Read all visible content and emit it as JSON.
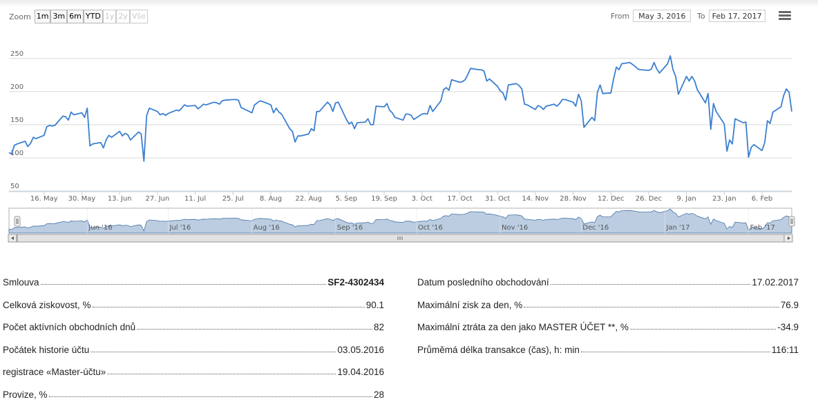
{
  "toolbar": {
    "zoom_label": "Zoom",
    "zoom_buttons": [
      {
        "label": "1m",
        "enabled": true
      },
      {
        "label": "3m",
        "enabled": true
      },
      {
        "label": "6m",
        "enabled": true
      },
      {
        "label": "YTD",
        "enabled": true
      },
      {
        "label": "1y",
        "enabled": false
      },
      {
        "label": "2y",
        "enabled": false
      },
      {
        "label": "Vše",
        "enabled": false
      }
    ],
    "from_label": "From",
    "from_value": "May 3, 2016",
    "to_label": "To",
    "to_value": "Feb 17, 2017"
  },
  "chart_data": {
    "type": "line",
    "color": "#3a7fcf",
    "ylim": [
      50,
      255
    ],
    "yticks": [
      50,
      100,
      150,
      200,
      250
    ],
    "xrange": [
      "2016-05-03",
      "2017-02-17"
    ],
    "xticks": [
      {
        "date": "2016-05-16",
        "label": "16. May"
      },
      {
        "date": "2016-05-30",
        "label": "30. May"
      },
      {
        "date": "2016-06-13",
        "label": "13. Jun"
      },
      {
        "date": "2016-06-27",
        "label": "27. Jun"
      },
      {
        "date": "2016-07-11",
        "label": "11. Jul"
      },
      {
        "date": "2016-07-25",
        "label": "25. Jul"
      },
      {
        "date": "2016-08-08",
        "label": "8. Aug"
      },
      {
        "date": "2016-08-22",
        "label": "22. Aug"
      },
      {
        "date": "2016-09-05",
        "label": "5. Sep"
      },
      {
        "date": "2016-09-19",
        "label": "19. Sep"
      },
      {
        "date": "2016-10-03",
        "label": "3. Oct"
      },
      {
        "date": "2016-10-17",
        "label": "17. Oct"
      },
      {
        "date": "2016-10-31",
        "label": "31. Oct"
      },
      {
        "date": "2016-11-14",
        "label": "14. Nov"
      },
      {
        "date": "2016-11-28",
        "label": "28. Nov"
      },
      {
        "date": "2016-12-12",
        "label": "12. Dec"
      },
      {
        "date": "2016-12-26",
        "label": "26. Dec"
      },
      {
        "date": "2017-01-09",
        "label": "9. Jan"
      },
      {
        "date": "2017-01-23",
        "label": "23. Jan"
      },
      {
        "date": "2017-02-06",
        "label": "6. Feb"
      }
    ],
    "navigator_labels": [
      {
        "date": "2016-06-01",
        "label": "Jun '16"
      },
      {
        "date": "2016-07-01",
        "label": "Jul '16"
      },
      {
        "date": "2016-08-01",
        "label": "Aug '16"
      },
      {
        "date": "2016-09-01",
        "label": "Sep '16"
      },
      {
        "date": "2016-10-01",
        "label": "Oct '16"
      },
      {
        "date": "2016-11-01",
        "label": "Nov '16"
      },
      {
        "date": "2016-12-01",
        "label": "Dec '16"
      },
      {
        "date": "2017-01-01",
        "label": "Jan '17"
      },
      {
        "date": "2017-02-01",
        "label": "Feb '17"
      }
    ],
    "series": [
      {
        "points": [
          [
            "2016-05-03",
            108
          ],
          [
            "2016-05-04",
            106
          ],
          [
            "2016-05-05",
            119
          ],
          [
            "2016-05-06",
            121
          ],
          [
            "2016-05-09",
            125
          ],
          [
            "2016-05-10",
            117
          ],
          [
            "2016-05-11",
            122
          ],
          [
            "2016-05-12",
            131
          ],
          [
            "2016-05-13",
            129
          ],
          [
            "2016-05-16",
            134
          ],
          [
            "2016-05-17",
            147
          ],
          [
            "2016-05-18",
            149
          ],
          [
            "2016-05-19",
            148
          ],
          [
            "2016-05-20",
            149
          ],
          [
            "2016-05-23",
            163
          ],
          [
            "2016-05-24",
            162
          ],
          [
            "2016-05-25",
            157
          ],
          [
            "2016-05-26",
            169
          ],
          [
            "2016-05-27",
            165
          ],
          [
            "2016-05-30",
            168
          ],
          [
            "2016-05-31",
            161
          ],
          [
            "2016-06-01",
            175
          ],
          [
            "2016-06-02",
            118
          ],
          [
            "2016-06-03",
            121
          ],
          [
            "2016-06-06",
            123
          ],
          [
            "2016-06-07",
            115
          ],
          [
            "2016-06-08",
            127
          ],
          [
            "2016-06-09",
            134
          ],
          [
            "2016-06-10",
            131
          ],
          [
            "2016-06-13",
            140
          ],
          [
            "2016-06-14",
            133
          ],
          [
            "2016-06-15",
            137
          ],
          [
            "2016-06-16",
            135
          ],
          [
            "2016-06-17",
            127
          ],
          [
            "2016-06-20",
            139
          ],
          [
            "2016-06-21",
            136
          ],
          [
            "2016-06-22",
            95
          ],
          [
            "2016-06-23",
            164
          ],
          [
            "2016-06-24",
            175
          ],
          [
            "2016-06-27",
            170
          ],
          [
            "2016-06-28",
            165
          ],
          [
            "2016-06-29",
            167
          ],
          [
            "2016-06-30",
            164
          ],
          [
            "2016-07-01",
            167
          ],
          [
            "2016-07-04",
            172
          ],
          [
            "2016-07-05",
            171
          ],
          [
            "2016-07-06",
            175
          ],
          [
            "2016-07-07",
            180
          ],
          [
            "2016-07-08",
            178
          ],
          [
            "2016-07-11",
            179
          ],
          [
            "2016-07-12",
            174
          ],
          [
            "2016-07-13",
            177
          ],
          [
            "2016-07-14",
            181
          ],
          [
            "2016-07-15",
            180
          ],
          [
            "2016-07-18",
            184
          ],
          [
            "2016-07-19",
            183
          ],
          [
            "2016-07-20",
            181
          ],
          [
            "2016-07-21",
            186
          ],
          [
            "2016-07-22",
            187
          ],
          [
            "2016-07-25",
            188
          ],
          [
            "2016-07-26",
            188
          ],
          [
            "2016-07-27",
            187
          ],
          [
            "2016-07-28",
            176
          ],
          [
            "2016-07-29",
            174
          ],
          [
            "2016-08-01",
            168
          ],
          [
            "2016-08-02",
            180
          ],
          [
            "2016-08-03",
            183
          ],
          [
            "2016-08-04",
            186
          ],
          [
            "2016-08-05",
            185
          ],
          [
            "2016-08-08",
            180
          ],
          [
            "2016-08-09",
            168
          ],
          [
            "2016-08-10",
            175
          ],
          [
            "2016-08-11",
            169
          ],
          [
            "2016-08-12",
            166
          ],
          [
            "2016-08-15",
            144
          ],
          [
            "2016-08-16",
            140
          ],
          [
            "2016-08-17",
            124
          ],
          [
            "2016-08-18",
            133
          ],
          [
            "2016-08-19",
            133
          ],
          [
            "2016-08-22",
            136
          ],
          [
            "2016-08-23",
            144
          ],
          [
            "2016-08-24",
            141
          ],
          [
            "2016-08-25",
            170
          ],
          [
            "2016-08-26",
            170
          ],
          [
            "2016-08-29",
            184
          ],
          [
            "2016-08-30",
            180
          ],
          [
            "2016-08-31",
            170
          ],
          [
            "2016-09-01",
            183
          ],
          [
            "2016-09-02",
            184
          ],
          [
            "2016-09-05",
            158
          ],
          [
            "2016-09-06",
            151
          ],
          [
            "2016-09-07",
            154
          ],
          [
            "2016-09-08",
            144
          ],
          [
            "2016-09-09",
            153
          ],
          [
            "2016-09-12",
            154
          ],
          [
            "2016-09-13",
            159
          ],
          [
            "2016-09-14",
            150
          ],
          [
            "2016-09-15",
            150
          ],
          [
            "2016-09-16",
            178
          ],
          [
            "2016-09-19",
            177
          ],
          [
            "2016-09-20",
            182
          ],
          [
            "2016-09-21",
            172
          ],
          [
            "2016-09-22",
            168
          ],
          [
            "2016-09-23",
            161
          ],
          [
            "2016-09-26",
            157
          ],
          [
            "2016-09-27",
            166
          ],
          [
            "2016-09-28",
            166
          ],
          [
            "2016-09-29",
            164
          ],
          [
            "2016-09-30",
            158
          ],
          [
            "2016-10-03",
            166
          ],
          [
            "2016-10-04",
            167
          ],
          [
            "2016-10-05",
            166
          ],
          [
            "2016-10-06",
            179
          ],
          [
            "2016-10-07",
            170
          ],
          [
            "2016-10-10",
            186
          ],
          [
            "2016-10-11",
            203
          ],
          [
            "2016-10-12",
            206
          ],
          [
            "2016-10-13",
            202
          ],
          [
            "2016-10-14",
            218
          ],
          [
            "2016-10-17",
            214
          ],
          [
            "2016-10-18",
            215
          ],
          [
            "2016-10-19",
            218
          ],
          [
            "2016-10-20",
            226
          ],
          [
            "2016-10-21",
            235
          ],
          [
            "2016-10-24",
            233
          ],
          [
            "2016-10-25",
            233
          ],
          [
            "2016-10-26",
            231
          ],
          [
            "2016-10-27",
            216
          ],
          [
            "2016-10-28",
            219
          ],
          [
            "2016-10-31",
            208
          ],
          [
            "2016-11-01",
            201
          ],
          [
            "2016-11-02",
            198
          ],
          [
            "2016-11-03",
            187
          ],
          [
            "2016-11-04",
            210
          ],
          [
            "2016-11-07",
            212
          ],
          [
            "2016-11-08",
            209
          ],
          [
            "2016-11-09",
            204
          ],
          [
            "2016-11-10",
            181
          ],
          [
            "2016-11-11",
            180
          ],
          [
            "2016-11-14",
            173
          ],
          [
            "2016-11-15",
            179
          ],
          [
            "2016-11-16",
            177
          ],
          [
            "2016-11-17",
            173
          ],
          [
            "2016-11-18",
            178
          ],
          [
            "2016-11-21",
            181
          ],
          [
            "2016-11-22",
            178
          ],
          [
            "2016-11-23",
            182
          ],
          [
            "2016-11-24",
            188
          ],
          [
            "2016-11-25",
            188
          ],
          [
            "2016-11-28",
            184
          ],
          [
            "2016-11-29",
            178
          ],
          [
            "2016-11-30",
            196
          ],
          [
            "2016-12-01",
            186
          ],
          [
            "2016-12-02",
            146
          ],
          [
            "2016-12-05",
            161
          ],
          [
            "2016-12-06",
            156
          ],
          [
            "2016-12-07",
            199
          ],
          [
            "2016-12-08",
            210
          ],
          [
            "2016-12-09",
            197
          ],
          [
            "2016-12-12",
            198
          ],
          [
            "2016-12-13",
            219
          ],
          [
            "2016-12-14",
            237
          ],
          [
            "2016-12-15",
            233
          ],
          [
            "2016-12-16",
            242
          ],
          [
            "2016-12-19",
            244
          ],
          [
            "2016-12-20",
            241
          ],
          [
            "2016-12-21",
            238
          ],
          [
            "2016-12-22",
            234
          ],
          [
            "2016-12-23",
            233
          ],
          [
            "2016-12-26",
            232
          ],
          [
            "2016-12-27",
            234
          ],
          [
            "2016-12-28",
            244
          ],
          [
            "2016-12-29",
            234
          ],
          [
            "2016-12-30",
            228
          ],
          [
            "2017-01-02",
            242
          ],
          [
            "2017-01-03",
            254
          ],
          [
            "2017-01-04",
            233
          ],
          [
            "2017-01-05",
            223
          ],
          [
            "2017-01-06",
            196
          ],
          [
            "2017-01-09",
            223
          ],
          [
            "2017-01-10",
            216
          ],
          [
            "2017-01-11",
            223
          ],
          [
            "2017-01-12",
            216
          ],
          [
            "2017-01-13",
            203
          ],
          [
            "2017-01-16",
            183
          ],
          [
            "2017-01-17",
            197
          ],
          [
            "2017-01-18",
            143
          ],
          [
            "2017-01-19",
            182
          ],
          [
            "2017-01-20",
            170
          ],
          [
            "2017-01-23",
            151
          ],
          [
            "2017-01-24",
            110
          ],
          [
            "2017-01-25",
            127
          ],
          [
            "2017-01-26",
            121
          ],
          [
            "2017-01-27",
            159
          ],
          [
            "2017-01-30",
            153
          ],
          [
            "2017-01-31",
            154
          ],
          [
            "2017-02-01",
            101
          ],
          [
            "2017-02-02",
            116
          ],
          [
            "2017-02-03",
            120
          ],
          [
            "2017-02-06",
            111
          ],
          [
            "2017-02-07",
            123
          ],
          [
            "2017-02-08",
            156
          ],
          [
            "2017-02-09",
            152
          ],
          [
            "2017-02-10",
            169
          ],
          [
            "2017-02-13",
            177
          ],
          [
            "2017-02-14",
            194
          ],
          [
            "2017-02-15",
            204
          ],
          [
            "2017-02-16",
            199
          ],
          [
            "2017-02-17",
            170
          ]
        ]
      }
    ]
  },
  "stats": {
    "left": [
      {
        "label": "Smlouva",
        "value": "SF2-4302434",
        "bold": true
      },
      {
        "label": "Celková ziskovost, %",
        "value": "90.1"
      },
      {
        "label": "Počet aktívních obchodních dnů",
        "value": "82"
      },
      {
        "label": "Počátek historie účtu",
        "value": "03.05.2016"
      },
      {
        "label": "registrace «Master-účtu»",
        "value": "19.04.2016"
      },
      {
        "label": "Provize, %",
        "value": "28"
      }
    ],
    "right": [
      {
        "label": "Datum posledního obchodování",
        "value": "17.02.2017"
      },
      {
        "label": "Maximální zisk za den, %",
        "value": "76.9"
      },
      {
        "label": "Maximální ztráta za den jako MASTER ÚČET **, %",
        "value": "-34.9"
      },
      {
        "label": "Průměmá délka transakce (čas), h: min",
        "value": "116:11"
      }
    ]
  }
}
